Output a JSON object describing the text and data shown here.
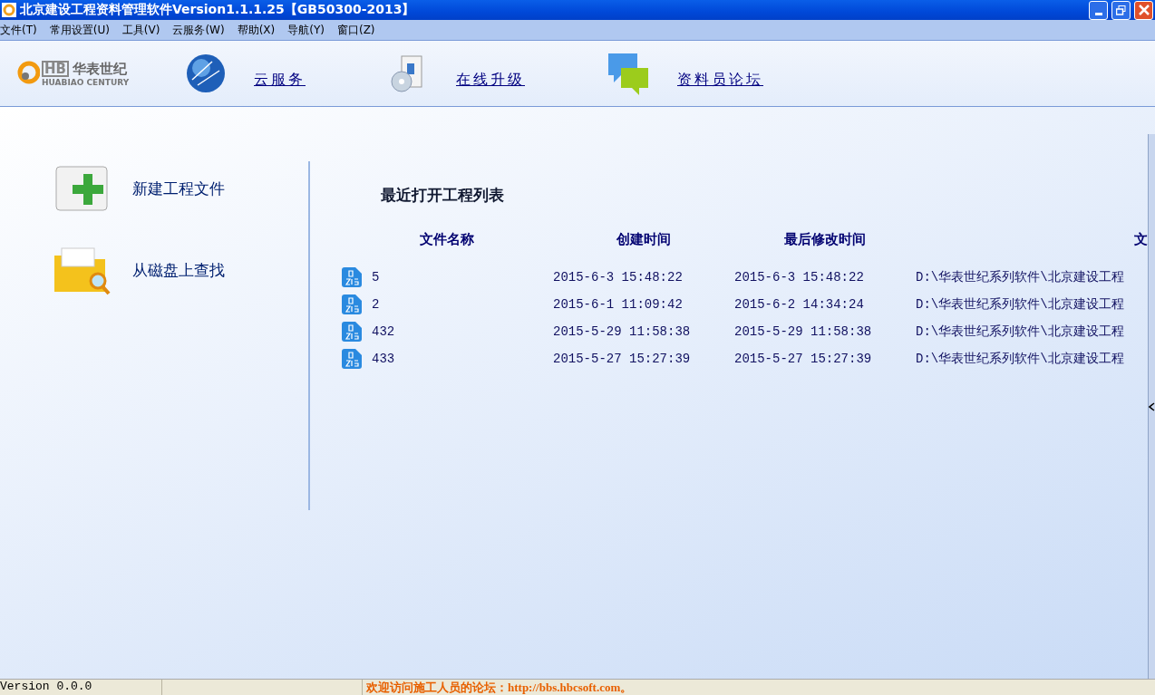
{
  "window": {
    "title": "北京建设工程资料管理软件Version1.1.1.25【GB50300-2013】"
  },
  "menu": [
    "文件(T)",
    "常用设置(U)",
    "工具(V)",
    "云服务(W)",
    "帮助(X)",
    "导航(Y)",
    "窗口(Z)"
  ],
  "logo": {
    "mark": "HB",
    "name": "华表世纪",
    "subtitle": "HUABIAO CENTURY"
  },
  "toolbar": [
    {
      "kind": "globe",
      "label": "云服务"
    },
    {
      "kind": "upgrade",
      "label": "在线升级"
    },
    {
      "kind": "forum",
      "label": "资料员论坛"
    }
  ],
  "actions": [
    {
      "kind": "new",
      "label": "新建工程文件"
    },
    {
      "kind": "open",
      "label": "从磁盘上查找"
    }
  ],
  "recent": {
    "title": "最近打开工程列表",
    "columns": [
      "文件名称",
      "创建时间",
      "最后修改时间",
      "文"
    ],
    "rows": [
      {
        "name": "5",
        "created": "2015-6-3 15:48:22",
        "modified": "2015-6-3 15:48:22",
        "path": "D:\\华表世纪系列软件\\北京建设工程"
      },
      {
        "name": "2",
        "created": "2015-6-1 11:09:42",
        "modified": "2015-6-2 14:34:24",
        "path": "D:\\华表世纪系列软件\\北京建设工程"
      },
      {
        "name": "432",
        "created": "2015-5-29 11:58:38",
        "modified": "2015-5-29 11:58:38",
        "path": "D:\\华表世纪系列软件\\北京建设工程"
      },
      {
        "name": "433",
        "created": "2015-5-27 15:27:39",
        "modified": "2015-5-27 15:27:39",
        "path": "D:\\华表世纪系列软件\\北京建设工程"
      }
    ]
  },
  "status_bar": {
    "version": "Version 0.0.0",
    "message": "欢迎访问施工人员的论坛：http://bbs.hbcsoft.com。"
  }
}
